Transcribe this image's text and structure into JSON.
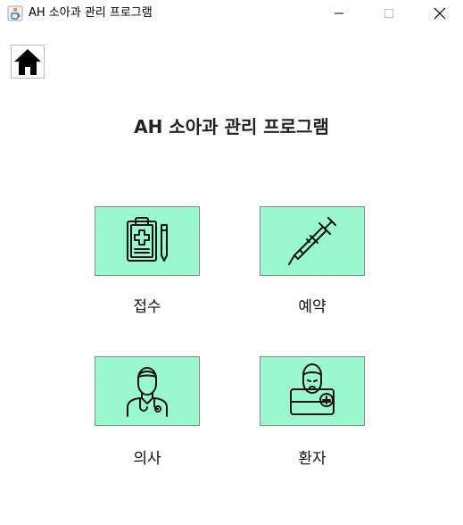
{
  "window": {
    "title": "AH 소아과 관리 프로그램",
    "icon": "java-cup-icon"
  },
  "header": {
    "home_icon": "home-icon",
    "title": "AH 소아과 관리 프로그램"
  },
  "menu": [
    {
      "label": "접수",
      "icon": "clipboard-medical-icon"
    },
    {
      "label": "예약",
      "icon": "syringe-icon"
    },
    {
      "label": "의사",
      "icon": "doctor-icon"
    },
    {
      "label": "환자",
      "icon": "patient-in-bed-icon"
    }
  ],
  "colors": {
    "tile_background": "#99f8d0",
    "tile_border": "#7a8f86"
  }
}
